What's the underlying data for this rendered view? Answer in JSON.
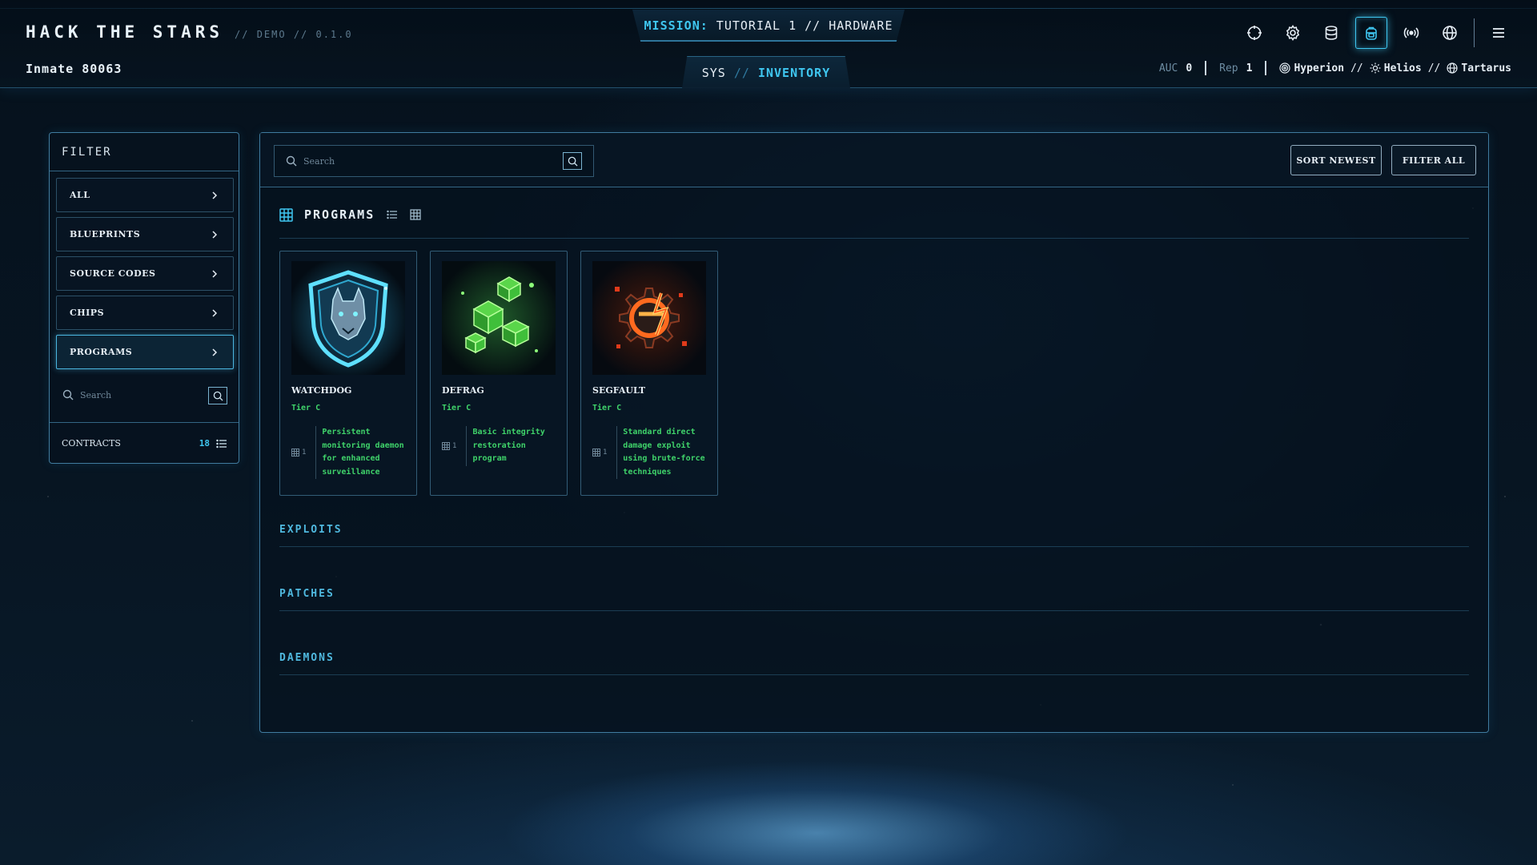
{
  "header": {
    "brand": "HACK THE STARS",
    "version": "// DEMO // 0.1.0",
    "inmate": "Inmate 80063",
    "mission_key": "MISSION:",
    "mission_value": "TUTORIAL 1 // HARDWARE",
    "sys_label": "SYS",
    "sys_sep": "//",
    "sys_active": "INVENTORY",
    "icons": [
      "crosshair-icon",
      "gear-icon",
      "database-icon",
      "backpack-icon",
      "broadcast-icon",
      "globe-icon",
      "menu-icon"
    ],
    "active_icon": "backpack-icon",
    "auc_label": "AUC",
    "auc_value": "0",
    "rep_label": "Rep",
    "rep_value": "1",
    "planets": [
      "Hyperion",
      "Helios",
      "Tartarus"
    ],
    "planet_sep": "//"
  },
  "filter": {
    "title": "FILTER",
    "items": [
      {
        "label": "ALL",
        "active": false
      },
      {
        "label": "BLUEPRINTS",
        "active": false
      },
      {
        "label": "SOURCE CODES",
        "active": false
      },
      {
        "label": "CHIPS",
        "active": false
      },
      {
        "label": "PROGRAMS",
        "active": true
      }
    ],
    "search_placeholder": "Search",
    "contracts_label": "CONTRACTS",
    "contracts_count": "18"
  },
  "main": {
    "search_placeholder": "Search",
    "sort_button": "SORT NEWEST",
    "filter_button": "FILTER ALL",
    "programs_title": "PROGRAMS",
    "cards": [
      {
        "name": "WATCHDOG",
        "tier": "Tier C",
        "qty": "1",
        "desc": "Persistent monitoring daemon for enhanced surveillance"
      },
      {
        "name": "DEFRAG",
        "tier": "Tier C",
        "qty": "1",
        "desc": "Basic integrity restoration program"
      },
      {
        "name": "SEGFAULT",
        "tier": "Tier C",
        "qty": "1",
        "desc": "Standard direct damage exploit using brute-force techniques"
      }
    ],
    "sections": [
      "EXPLOITS",
      "PATCHES",
      "DAEMONS"
    ]
  },
  "colors": {
    "accent": "#3fc6f0",
    "tier_green": "#3fd36a",
    "border": "#5aaad7"
  }
}
